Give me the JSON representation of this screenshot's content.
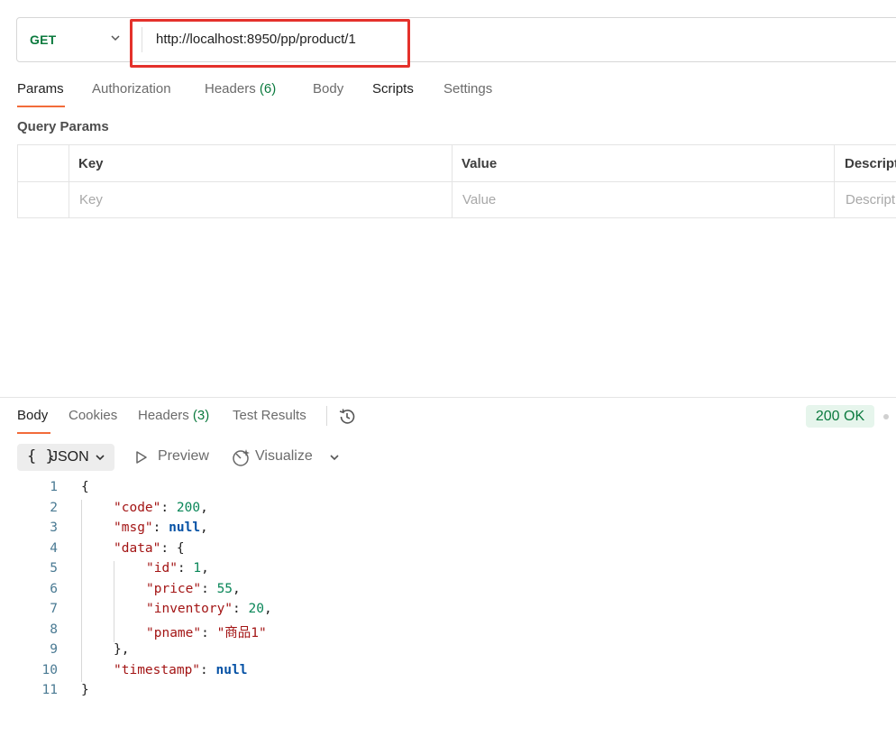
{
  "request": {
    "method": "GET",
    "url": "http://localhost:8950/pp/product/1"
  },
  "request_tabs": {
    "params": "Params",
    "authorization": "Authorization",
    "headers": "Headers",
    "headers_count": "(6)",
    "body": "Body",
    "scripts": "Scripts",
    "settings": "Settings"
  },
  "query_params": {
    "title": "Query Params",
    "columns": [
      "Key",
      "Value",
      "Descripti"
    ],
    "placeholders": [
      "Key",
      "Value",
      "Descripti"
    ]
  },
  "response_tabs": {
    "body": "Body",
    "cookies": "Cookies",
    "headers": "Headers",
    "headers_count": "(3)",
    "test_results": "Test Results"
  },
  "status": {
    "text": "200 OK",
    "color": "#0b7a3e"
  },
  "format": {
    "braces": "{ }",
    "label": "JSON",
    "preview": "Preview",
    "visualize": "Visualize"
  },
  "code": {
    "line_numbers": [
      "1",
      "2",
      "3",
      "4",
      "5",
      "6",
      "7",
      "8",
      "9",
      "10",
      "11"
    ],
    "lines": [
      {
        "open": "{"
      },
      {
        "key": "\"code\"",
        "sep": ": ",
        "num": "200",
        "end": ","
      },
      {
        "key": "\"msg\"",
        "sep": ": ",
        "kw": "null",
        "end": ","
      },
      {
        "key": "\"data\"",
        "sep": ": ",
        "open": "{"
      },
      {
        "key": "\"id\"",
        "sep": ": ",
        "num": "1",
        "end": ","
      },
      {
        "key": "\"price\"",
        "sep": ": ",
        "num": "55",
        "end": ","
      },
      {
        "key": "\"inventory\"",
        "sep": ": ",
        "num": "20",
        "end": ","
      },
      {
        "key": "\"pname\"",
        "sep": ": ",
        "str": "\"商品1\""
      },
      {
        "close": "},"
      },
      {
        "key": "\"timestamp\"",
        "sep": ": ",
        "kw": "null"
      },
      {
        "close": "}"
      }
    ]
  },
  "colors": {
    "accent": "#f26b3a",
    "highlight_box": "#e4312b"
  }
}
